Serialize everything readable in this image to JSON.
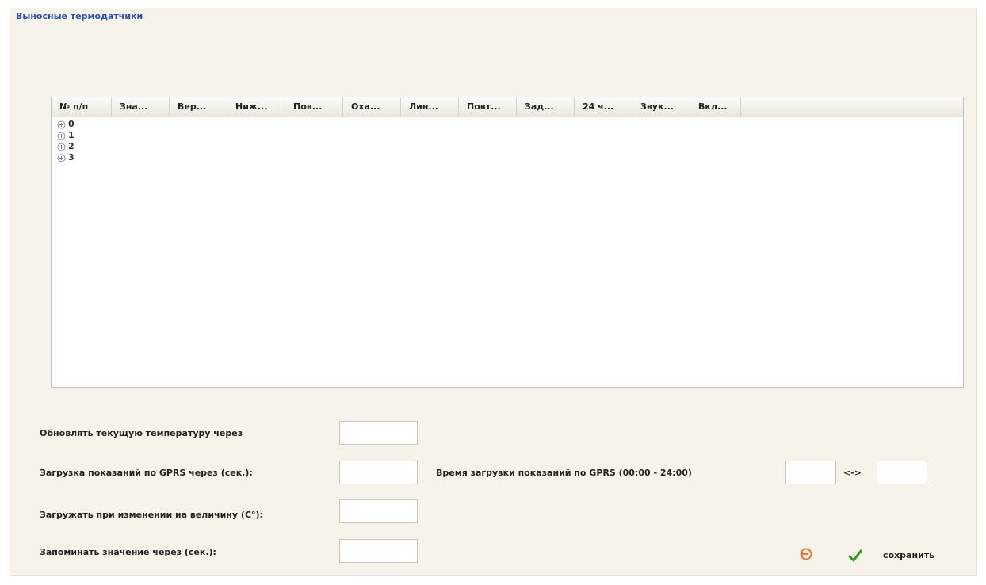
{
  "panel": {
    "title": "Выносные термодатчики"
  },
  "table": {
    "columns": [
      "№ п/п",
      "Зна...",
      "Вер...",
      "Ниж...",
      "Пов...",
      "Оха...",
      "Лин...",
      "Повт...",
      "Зад...",
      "24 ч...",
      "Звук...",
      "Вкл..."
    ],
    "rows": [
      "0",
      "1",
      "2",
      "3"
    ]
  },
  "form": {
    "update_temp_label": "Обновлять текущую температуру через",
    "update_temp_value": "",
    "gprs_interval_label": "Загрузка показаний по GPRS через (сек.):",
    "gprs_interval_value": "",
    "gprs_time_label": "Время загрузки показаний по GPRS (00:00 - 24:00)",
    "gprs_time_from": "",
    "range_separator": "<->",
    "gprs_time_to": "",
    "change_threshold_label": "Загружать при изменении на величину (С°):",
    "change_threshold_value": "",
    "remember_label": "Запоминать значение через (сек.):",
    "remember_value": ""
  },
  "actions": {
    "save_label": "сохранить",
    "cancel_icon": "undo-icon",
    "save_icon": "checkmark-icon"
  },
  "colors": {
    "title": "#2b4fb0",
    "panel_bg": "#f6f4ea",
    "cancel_icon": "#e8742a",
    "save_icon": "#2e9a1e"
  }
}
